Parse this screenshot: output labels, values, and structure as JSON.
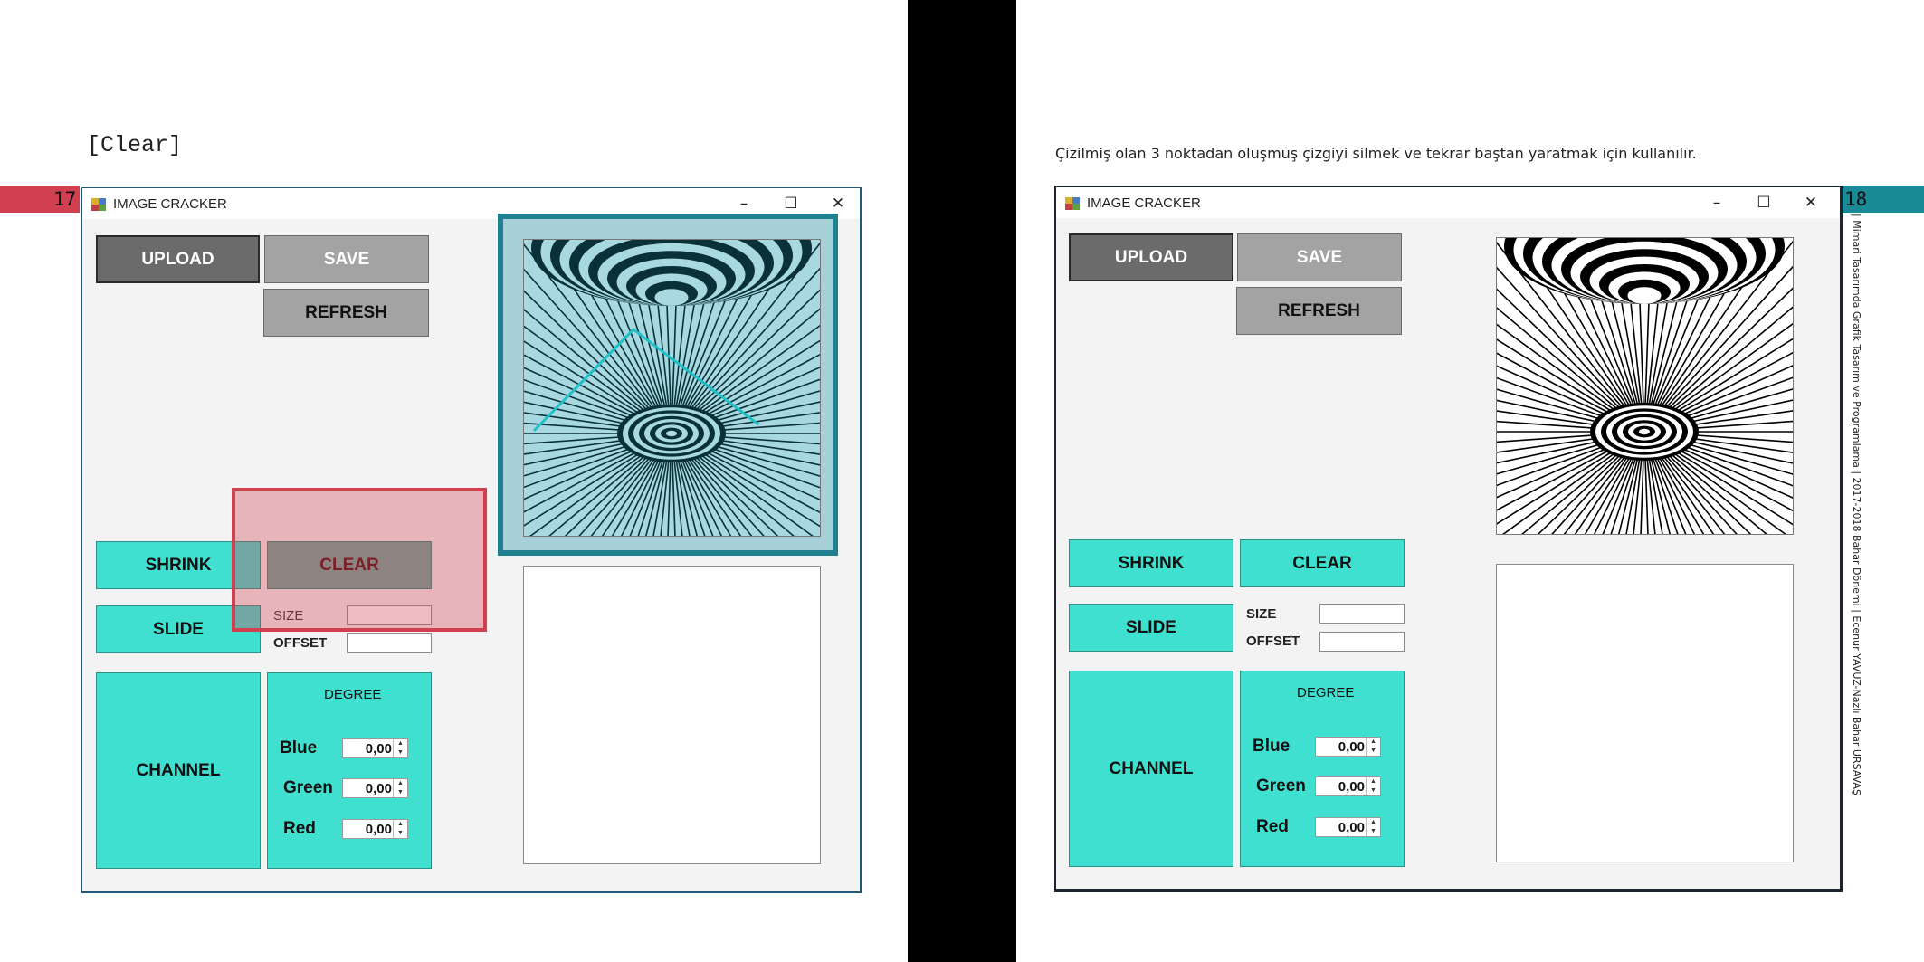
{
  "left_page": {
    "heading": "[Clear]",
    "page_number": "17",
    "page_bar_color": "#d04050"
  },
  "right_page": {
    "caption": "Çizilmiş olan 3 noktadan oluşmuş çizgiyi silmek ve tekrar baştan yaratmak  için kullanılır.",
    "page_number": "18",
    "page_bar_color": "#1a8a96",
    "side_note": "| Mimari Tasarımda Grafik Tasarım ve Programlama | 2017-2018 Bahar Dönemi | Ecenur YAVUZ-Nazlı Bahar URSAVAŞ"
  },
  "window": {
    "title": "IMAGE CRACKER",
    "minimize": "–",
    "maximize": "☐",
    "close": "✕",
    "buttons": {
      "upload": "UPLOAD",
      "save": "SAVE",
      "refresh": "REFRESH",
      "shrink": "SHRINK",
      "clear": "CLEAR",
      "slide": "SLIDE",
      "channel": "CHANNEL"
    },
    "fields": {
      "size_label": "SIZE",
      "offset_label": "OFFSET",
      "size_value": "",
      "offset_value": ""
    },
    "degree": {
      "title": "DEGREE",
      "channels": [
        {
          "label": "Blue",
          "value": "0,00"
        },
        {
          "label": "Green",
          "value": "0,00"
        },
        {
          "label": "Red",
          "value": "0,00"
        }
      ]
    }
  },
  "colors": {
    "accent_teal": "#40e0d0",
    "highlight_red": "#d04050",
    "highlight_teal": "#1f8090",
    "drawn_line": "#20c0c8"
  }
}
